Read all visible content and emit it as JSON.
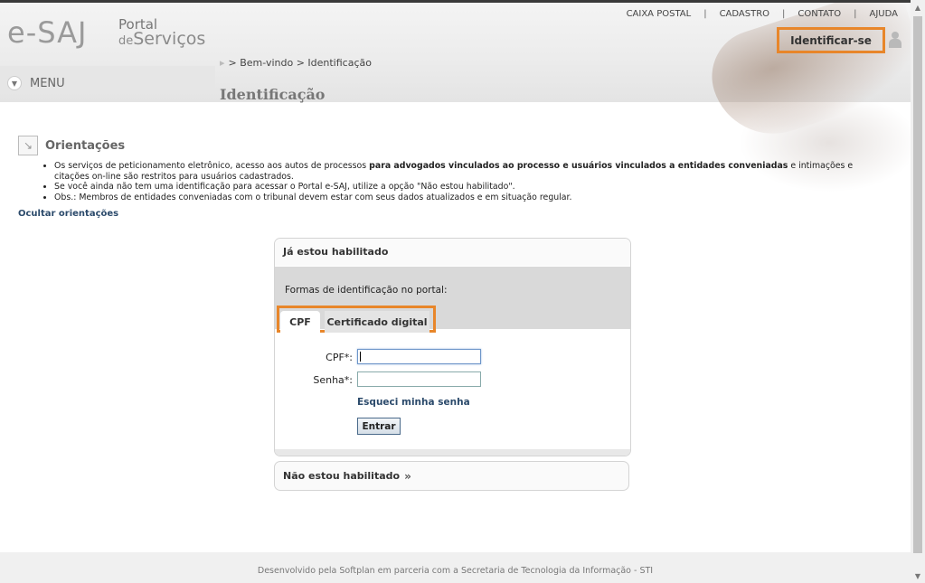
{
  "header": {
    "logo_esaj": "e-SAJ",
    "logo_portal": "Portal",
    "logo_servicos_prefix": "de",
    "logo_servicos": "Serviços",
    "top_links": [
      "CAIXA POSTAL",
      "CADASTRO",
      "CONTATO",
      "AJUDA"
    ],
    "identify_button": "Identificar-se",
    "breadcrumb": "> Bem-vindo > Identificação",
    "menu_label": "MENU",
    "page_title": "Identificação"
  },
  "orientacoes": {
    "title": "Orientações",
    "items": [
      {
        "pre": "Os serviços de peticionamento eletrônico, acesso aos autos de processos ",
        "bold": "para advogados vinculados ao processo e usuários vinculados a entidades conveniadas",
        "post": " e intimações e citações on-line são restritos para usuários cadastrados."
      },
      {
        "pre": "Se você ainda não tem uma identificação para acessar o Portal e-SAJ, utilize a opção \"Não estou habilitado\".",
        "bold": "",
        "post": ""
      },
      {
        "pre": "Obs.: Membros de entidades conveniadas com o tribunal devem estar com seus dados atualizados e em situação regular.",
        "bold": "",
        "post": ""
      }
    ],
    "hide_link": "Ocultar orientações"
  },
  "login": {
    "box_title": "Já estou habilitado",
    "formas_label": "Formas de identificação no portal:",
    "tabs": [
      "CPF",
      "Certificado digital"
    ],
    "cpf_label": "CPF*:",
    "cpf_value": "",
    "senha_label": "Senha*:",
    "senha_value": "",
    "forgot_link": "Esqueci minha senha",
    "submit_button": "Entrar"
  },
  "not_enabled": {
    "label": "Não estou habilitado",
    "chevron": "»"
  },
  "footer": {
    "text": "Desenvolvido pela Softplan em parceria com a Secretaria de Tecnologia da Informação - STI"
  },
  "colors": {
    "highlight": "#e8862a",
    "link": "#2b4a6b"
  }
}
